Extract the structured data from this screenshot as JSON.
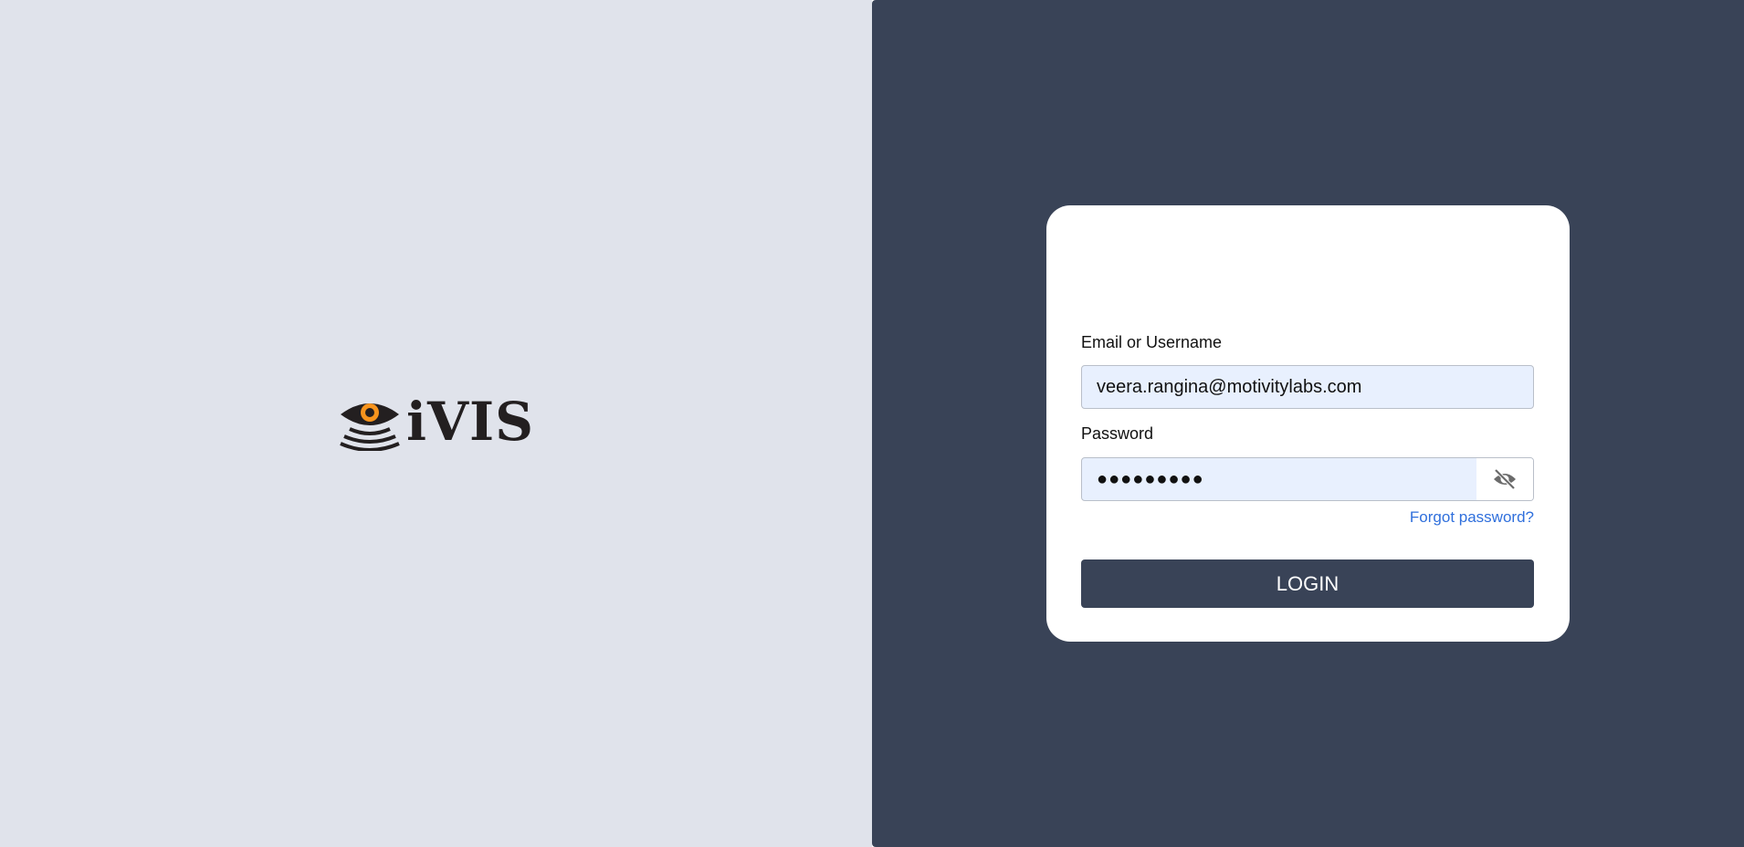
{
  "brand": {
    "name": "iVIS",
    "colors": {
      "eye_orange": "#f7941d",
      "dark": "#231f20"
    }
  },
  "form": {
    "email_label": "Email or Username",
    "email_value": "veera.rangina@motivitylabs.com",
    "password_label": "Password",
    "password_masked": "●●●●●●●●●",
    "password_toggle_icon": "eye-off-icon",
    "forgot_label": "Forgot password?",
    "login_label": "LOGIN"
  },
  "colors": {
    "left_bg": "#e0e3eb",
    "right_bg": "#394357",
    "link": "#2f6fdc",
    "input_bg": "#e8f0fe"
  }
}
